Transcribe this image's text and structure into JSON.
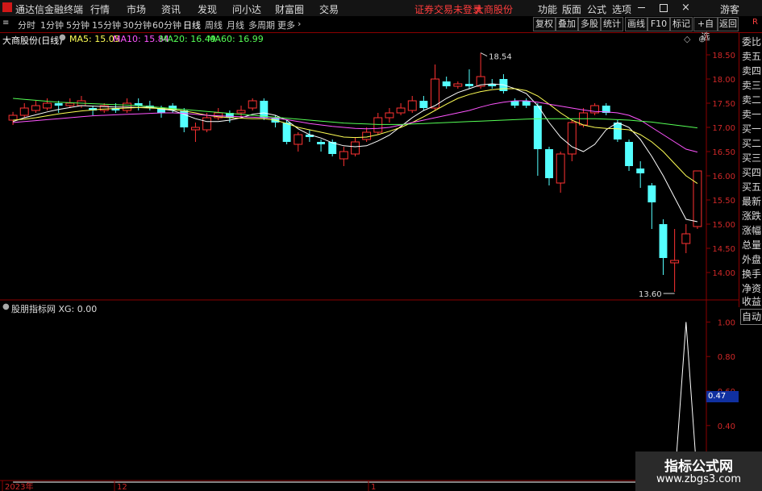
{
  "app": {
    "title": "通达信金融终端"
  },
  "menu": [
    "行情",
    "市场",
    "资讯",
    "发现",
    "问小达",
    "财富圈",
    "交易"
  ],
  "notice": {
    "text": "证券交易未登录",
    "stock": "大商股份"
  },
  "menu_right": [
    "功能",
    "版面",
    "公式",
    "选项"
  ],
  "guest": "游客",
  "corner": "R",
  "periods": [
    "分时",
    "1分钟",
    "5分钟",
    "15分钟",
    "30分钟",
    "60分钟",
    "日线",
    "周线",
    "月线",
    "多周期",
    "更多"
  ],
  "toolbar_buttons": [
    "复权",
    "叠加",
    "多股",
    "统计",
    "画线",
    "F10",
    "标记",
    "+自选",
    "返回"
  ],
  "side_panel": [
    "委比",
    "卖五",
    "卖四",
    "卖三",
    "卖二",
    "卖一",
    "买一",
    "买二",
    "买三",
    "买四",
    "买五",
    "最新",
    "涨跌",
    "涨幅",
    "总量",
    "外盘",
    "换手",
    "净资",
    "收益"
  ],
  "auto_label": "自动",
  "main_chart": {
    "title": "大商股份(日线)",
    "ma": [
      {
        "label": "MA5: 15.05",
        "color": "#ffffff"
      },
      {
        "label": "MA10: 15.84",
        "color": "#ffff55"
      },
      {
        "label": "MA20: 16.49",
        "color": "#ff55ff"
      },
      {
        "label": "MA60: 16.99",
        "color": "#55ff55"
      }
    ],
    "high_label": "18.54",
    "low_label": "13.60"
  },
  "indicator": {
    "title": "股朋指标网 XG: 0.00",
    "current": "0.47"
  },
  "x_labels": [
    "2023年",
    "12",
    "1"
  ],
  "watermark": {
    "line1": "指标公式网",
    "line2": "www.zbgs3.com"
  },
  "chart_data": [
    {
      "type": "candlestick",
      "title": "大商股份(日线)",
      "ylim": [
        13.6,
        18.8
      ],
      "yticks": [
        14.0,
        14.5,
        15.0,
        15.5,
        16.0,
        16.5,
        17.0,
        17.5,
        18.0,
        18.5
      ],
      "up_color": "#ff3232",
      "down_color": "#54ffff",
      "candles": [
        {
          "o": 17.15,
          "c": 17.25,
          "h": 17.32,
          "l": 17.05
        },
        {
          "o": 17.25,
          "c": 17.4,
          "h": 17.5,
          "l": 17.2
        },
        {
          "o": 17.35,
          "c": 17.45,
          "h": 17.55,
          "l": 17.3
        },
        {
          "o": 17.4,
          "c": 17.5,
          "h": 17.6,
          "l": 17.35
        },
        {
          "o": 17.5,
          "c": 17.45,
          "h": 17.55,
          "l": 17.3
        },
        {
          "o": 17.45,
          "c": 17.5,
          "h": 17.6,
          "l": 17.4
        },
        {
          "o": 17.45,
          "c": 17.55,
          "h": 17.65,
          "l": 17.4
        },
        {
          "o": 17.4,
          "c": 17.35,
          "h": 17.45,
          "l": 17.25
        },
        {
          "o": 17.35,
          "c": 17.45,
          "h": 17.5,
          "l": 17.3
        },
        {
          "o": 17.4,
          "c": 17.35,
          "h": 17.5,
          "l": 17.3
        },
        {
          "o": 17.35,
          "c": 17.5,
          "h": 17.6,
          "l": 17.3
        },
        {
          "o": 17.5,
          "c": 17.45,
          "h": 17.6,
          "l": 17.35
        },
        {
          "o": 17.45,
          "c": 17.4,
          "h": 17.55,
          "l": 17.35
        },
        {
          "o": 17.4,
          "c": 17.3,
          "h": 17.45,
          "l": 17.2
        },
        {
          "o": 17.45,
          "c": 17.35,
          "h": 17.5,
          "l": 17.3
        },
        {
          "o": 17.35,
          "c": 17.0,
          "h": 17.4,
          "l": 16.9
        },
        {
          "o": 16.95,
          "c": 17.0,
          "h": 17.1,
          "l": 16.7
        },
        {
          "o": 16.95,
          "c": 17.2,
          "h": 17.3,
          "l": 16.9
        },
        {
          "o": 17.2,
          "c": 17.3,
          "h": 17.4,
          "l": 17.15
        },
        {
          "o": 17.3,
          "c": 17.2,
          "h": 17.35,
          "l": 17.1
        },
        {
          "o": 17.3,
          "c": 17.35,
          "h": 17.45,
          "l": 17.2
        },
        {
          "o": 17.4,
          "c": 17.55,
          "h": 17.6,
          "l": 17.35
        },
        {
          "o": 17.55,
          "c": 17.2,
          "h": 17.6,
          "l": 17.15
        },
        {
          "o": 17.2,
          "c": 17.1,
          "h": 17.25,
          "l": 17.0
        },
        {
          "o": 17.1,
          "c": 16.7,
          "h": 17.15,
          "l": 16.65
        },
        {
          "o": 16.65,
          "c": 16.85,
          "h": 16.9,
          "l": 16.5
        },
        {
          "o": 16.85,
          "c": 16.8,
          "h": 16.95,
          "l": 16.7
        },
        {
          "o": 16.7,
          "c": 16.65,
          "h": 16.75,
          "l": 16.5
        },
        {
          "o": 16.7,
          "c": 16.45,
          "h": 16.75,
          "l": 16.4
        },
        {
          "o": 16.35,
          "c": 16.5,
          "h": 16.6,
          "l": 16.2
        },
        {
          "o": 16.45,
          "c": 16.7,
          "h": 16.8,
          "l": 16.4
        },
        {
          "o": 16.75,
          "c": 16.9,
          "h": 17.0,
          "l": 16.7
        },
        {
          "o": 16.9,
          "c": 17.2,
          "h": 17.3,
          "l": 16.85
        },
        {
          "o": 17.2,
          "c": 17.3,
          "h": 17.4,
          "l": 17.1
        },
        {
          "o": 17.3,
          "c": 17.4,
          "h": 17.5,
          "l": 17.25
        },
        {
          "o": 17.35,
          "c": 17.55,
          "h": 17.65,
          "l": 17.3
        },
        {
          "o": 17.55,
          "c": 17.4,
          "h": 17.65,
          "l": 17.35
        },
        {
          "o": 17.4,
          "c": 18.0,
          "h": 18.3,
          "l": 17.35
        },
        {
          "o": 17.95,
          "c": 17.85,
          "h": 18.05,
          "l": 17.8
        },
        {
          "o": 17.85,
          "c": 17.9,
          "h": 17.95,
          "l": 17.8
        },
        {
          "o": 17.9,
          "c": 17.85,
          "h": 18.2,
          "l": 17.8
        },
        {
          "o": 17.85,
          "c": 18.05,
          "h": 18.54,
          "l": 17.8
        },
        {
          "o": 17.9,
          "c": 17.85,
          "h": 18.0,
          "l": 17.8
        },
        {
          "o": 18.0,
          "c": 17.75,
          "h": 18.1,
          "l": 17.7
        },
        {
          "o": 17.55,
          "c": 17.45,
          "h": 17.6,
          "l": 17.4
        },
        {
          "o": 17.55,
          "c": 17.45,
          "h": 17.6,
          "l": 17.4
        },
        {
          "o": 17.45,
          "c": 16.55,
          "h": 17.5,
          "l": 16.0
        },
        {
          "o": 16.55,
          "c": 15.95,
          "h": 16.6,
          "l": 15.8
        },
        {
          "o": 15.85,
          "c": 16.45,
          "h": 16.5,
          "l": 15.65
        },
        {
          "o": 16.45,
          "c": 17.1,
          "h": 17.15,
          "l": 16.3
        },
        {
          "o": 17.05,
          "c": 17.3,
          "h": 17.4,
          "l": 17.0
        },
        {
          "o": 17.3,
          "c": 17.45,
          "h": 17.5,
          "l": 17.25
        },
        {
          "o": 17.45,
          "c": 17.3,
          "h": 17.5,
          "l": 17.25
        },
        {
          "o": 17.1,
          "c": 16.75,
          "h": 17.15,
          "l": 16.7
        },
        {
          "o": 16.7,
          "c": 16.2,
          "h": 16.75,
          "l": 16.1
        },
        {
          "o": 16.15,
          "c": 16.05,
          "h": 16.3,
          "l": 15.75
        },
        {
          "o": 15.8,
          "c": 15.45,
          "h": 15.85,
          "l": 14.9
        },
        {
          "o": 15.0,
          "c": 14.3,
          "h": 15.1,
          "l": 13.95
        },
        {
          "o": 14.2,
          "c": 14.25,
          "h": 14.9,
          "l": 13.6
        },
        {
          "o": 14.6,
          "c": 14.8,
          "h": 15.0,
          "l": 14.4
        },
        {
          "o": 14.95,
          "c": 16.1,
          "h": 16.1,
          "l": 14.9
        }
      ],
      "ma_lines": [
        {
          "name": "MA5",
          "color": "#ffffff",
          "values": [
            17.12,
            17.2,
            17.26,
            17.32,
            17.37,
            17.41,
            17.45,
            17.44,
            17.43,
            17.42,
            17.42,
            17.41,
            17.42,
            17.38,
            17.35,
            17.27,
            17.18,
            17.12,
            17.12,
            17.15,
            17.2,
            17.27,
            17.3,
            17.25,
            17.15,
            16.97,
            16.85,
            16.78,
            16.68,
            16.62,
            16.6,
            16.62,
            16.72,
            16.84,
            17.02,
            17.2,
            17.35,
            17.45,
            17.6,
            17.72,
            17.8,
            17.88,
            17.9,
            17.88,
            17.8,
            17.7,
            17.45,
            17.1,
            16.8,
            16.6,
            16.5,
            16.65,
            16.95,
            17.1,
            17.0,
            16.75,
            16.4,
            16.0,
            15.55,
            15.1,
            15.05
          ]
        },
        {
          "name": "MA10",
          "color": "#ffff55",
          "values": [
            17.15,
            17.17,
            17.2,
            17.24,
            17.28,
            17.31,
            17.34,
            17.36,
            17.38,
            17.39,
            17.4,
            17.41,
            17.4,
            17.39,
            17.37,
            17.34,
            17.3,
            17.25,
            17.22,
            17.2,
            17.19,
            17.18,
            17.18,
            17.15,
            17.08,
            17.0,
            16.95,
            16.9,
            16.85,
            16.8,
            16.79,
            16.8,
            16.85,
            16.92,
            17.0,
            17.1,
            17.22,
            17.35,
            17.48,
            17.6,
            17.68,
            17.74,
            17.78,
            17.8,
            17.8,
            17.76,
            17.65,
            17.48,
            17.3,
            17.15,
            17.05,
            17.0,
            16.98,
            16.97,
            16.95,
            16.85,
            16.7,
            16.5,
            16.25,
            16.0,
            15.84
          ]
        },
        {
          "name": "MA20",
          "color": "#ff55ff",
          "values": [
            17.1,
            17.12,
            17.14,
            17.16,
            17.18,
            17.2,
            17.22,
            17.24,
            17.25,
            17.26,
            17.27,
            17.28,
            17.29,
            17.3,
            17.3,
            17.29,
            17.27,
            17.25,
            17.24,
            17.23,
            17.22,
            17.21,
            17.2,
            17.19,
            17.16,
            17.12,
            17.08,
            17.05,
            17.02,
            17.0,
            16.98,
            16.97,
            16.98,
            17.0,
            17.05,
            17.1,
            17.15,
            17.2,
            17.25,
            17.3,
            17.35,
            17.42,
            17.48,
            17.52,
            17.55,
            17.55,
            17.52,
            17.48,
            17.44,
            17.4,
            17.36,
            17.33,
            17.32,
            17.3,
            17.25,
            17.15,
            17.0,
            16.85,
            16.7,
            16.55,
            16.49
          ]
        },
        {
          "name": "MA60",
          "color": "#55ff55",
          "values": [
            17.6,
            17.58,
            17.56,
            17.54,
            17.52,
            17.51,
            17.5,
            17.49,
            17.48,
            17.47,
            17.46,
            17.45,
            17.43,
            17.41,
            17.39,
            17.37,
            17.35,
            17.33,
            17.31,
            17.29,
            17.27,
            17.25,
            17.23,
            17.21,
            17.19,
            17.17,
            17.15,
            17.13,
            17.11,
            17.09,
            17.08,
            17.07,
            17.06,
            17.06,
            17.06,
            17.07,
            17.08,
            17.09,
            17.1,
            17.11,
            17.12,
            17.13,
            17.14,
            17.15,
            17.16,
            17.17,
            17.18,
            17.18,
            17.18,
            17.18,
            17.18,
            17.18,
            17.17,
            17.16,
            17.15,
            17.13,
            17.11,
            17.08,
            17.05,
            17.02,
            16.99
          ]
        }
      ],
      "annotations": [
        {
          "text": "18.54",
          "index": 41,
          "value": 18.54
        },
        {
          "text": "13.60",
          "index": 58,
          "value": 13.6
        }
      ]
    },
    {
      "type": "line",
      "title": "股朋指标网 XG: 0.00",
      "ylim": [
        0.1,
        1.1
      ],
      "yticks": [
        1.0,
        0.8,
        0.6,
        0.4,
        0.2
      ],
      "current": 0.47,
      "series": [
        {
          "color": "#ffffff",
          "values": [
            0,
            0,
            0,
            0,
            0,
            0,
            0,
            0,
            0,
            0,
            0,
            0,
            0,
            0,
            0,
            0,
            0,
            0,
            0,
            0,
            0,
            0,
            0,
            0,
            0,
            0,
            0,
            0,
            0,
            0,
            0,
            0,
            0,
            0,
            0,
            0,
            0,
            0,
            0,
            0,
            0,
            0,
            0,
            0,
            0,
            0,
            0,
            0,
            0,
            0,
            0,
            0,
            0,
            0,
            0,
            0,
            0,
            0,
            0,
            1,
            0
          ]
        }
      ]
    }
  ]
}
